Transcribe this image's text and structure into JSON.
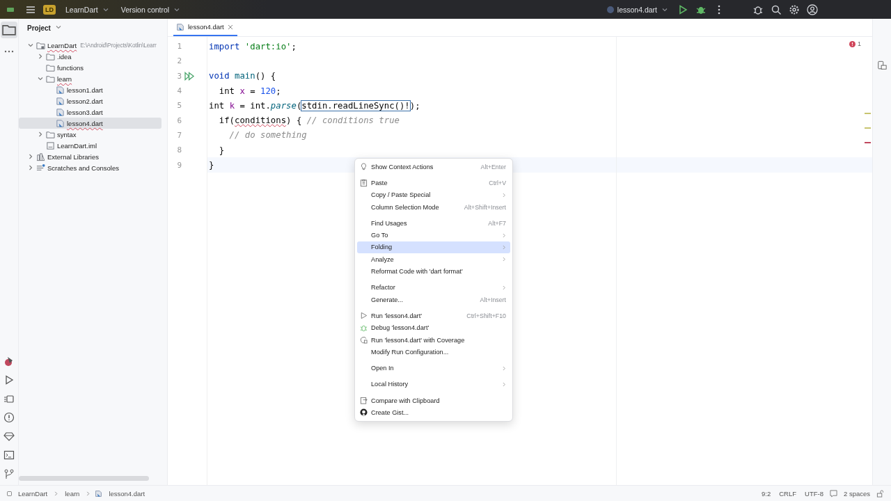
{
  "title_bar": {
    "project_badge": "LD",
    "project": "LearnDart",
    "vcs": "Version control",
    "run_config": "lesson4.dart"
  },
  "project_panel": {
    "title": "Project",
    "tree": [
      {
        "label": "LearnDart",
        "path": "E:\\Android\\Projects\\Kotlin\\Learr",
        "kind": "module",
        "expanded": true,
        "selected": false,
        "children": [
          {
            "label": ".idea",
            "kind": "folder",
            "expanded": false,
            "selected": false
          },
          {
            "label": "functions",
            "kind": "folder",
            "selected": false
          },
          {
            "label": "learn",
            "kind": "folder",
            "expanded": true,
            "selected": false,
            "children": [
              {
                "label": "lesson1.dart",
                "kind": "dart",
                "selected": false
              },
              {
                "label": "lesson2.dart",
                "kind": "dart",
                "selected": false
              },
              {
                "label": "lesson3.dart",
                "kind": "dart",
                "selected": false
              },
              {
                "label": "lesson4.dart",
                "kind": "dart",
                "selected": true
              }
            ]
          },
          {
            "label": "syntax",
            "kind": "folder",
            "expanded": false,
            "selected": false
          },
          {
            "label": "LearnDart.iml",
            "kind": "file",
            "selected": false
          }
        ]
      },
      {
        "label": "External Libraries",
        "kind": "library",
        "expanded": false,
        "selected": false
      },
      {
        "label": "Scratches and Consoles",
        "kind": "scratch",
        "expanded": false,
        "selected": false
      }
    ]
  },
  "editor": {
    "tab": "lesson4.dart",
    "problems": "1",
    "lines": [
      {
        "number": "1",
        "tokens": [
          {
            "kind": "keyword",
            "text": "import "
          },
          {
            "kind": "string",
            "text": "'dart:io'"
          },
          {
            "kind": "plain",
            "text": ";"
          }
        ]
      },
      {
        "number": "2"
      },
      {
        "number": "3",
        "run": true,
        "tokens": [
          {
            "kind": "keyword",
            "text": "void "
          },
          {
            "kind": "function",
            "text": "main"
          },
          {
            "kind": "plain",
            "text": "() {"
          }
        ]
      },
      {
        "number": "4",
        "tokens": [
          {
            "kind": "plain",
            "text": "  int "
          },
          {
            "kind": "variable",
            "text": "x"
          },
          {
            "kind": "plain",
            "text": " = "
          },
          {
            "kind": "number",
            "text": "120"
          },
          {
            "kind": "plain",
            "text": ";"
          }
        ]
      },
      {
        "number": "5",
        "tokens": [
          {
            "kind": "plain",
            "text": "int "
          },
          {
            "kind": "variable",
            "text": "k"
          },
          {
            "kind": "plain",
            "text": " = int."
          },
          {
            "kind": "italic",
            "text": "parse"
          },
          {
            "kind": "plain",
            "text": "("
          },
          {
            "kind": "boxed",
            "text": "stdin.readLineSync()!"
          },
          {
            "kind": "plain",
            "text": ");"
          }
        ]
      },
      {
        "number": "6",
        "tokens": [
          {
            "kind": "plain",
            "text": "  if("
          },
          {
            "kind": "error",
            "text": "conditions"
          },
          {
            "kind": "plain",
            "text": ") { "
          },
          {
            "kind": "comment",
            "text": "// conditions true"
          }
        ]
      },
      {
        "number": "7",
        "tokens": [
          {
            "kind": "comment",
            "text": "    // do something"
          }
        ]
      },
      {
        "number": "8",
        "tokens": [
          {
            "kind": "plain",
            "text": "  }"
          }
        ]
      },
      {
        "number": "9",
        "tokens": [
          {
            "kind": "plain",
            "text": "}"
          }
        ]
      }
    ]
  },
  "context_menu": [
    [
      {
        "label": "Show Context Actions",
        "shortcut": "Alt+Enter",
        "kind": "bulb",
        "submenu": false,
        "selected": false
      }
    ],
    [
      {
        "label": "Paste",
        "shortcut": "Ctrl+V",
        "kind": "clipboard",
        "submenu": false,
        "selected": false
      },
      {
        "label": "Copy / Paste Special",
        "submenu": true,
        "selected": false
      },
      {
        "label": "Column Selection Mode",
        "shortcut": "Alt+Shift+Insert",
        "submenu": false,
        "selected": false
      }
    ],
    [
      {
        "label": "Find Usages",
        "shortcut": "Alt+F7",
        "submenu": false,
        "selected": false
      },
      {
        "label": "Go To",
        "submenu": true,
        "selected": false
      },
      {
        "label": "Folding",
        "submenu": true,
        "selected": true
      },
      {
        "label": "Analyze",
        "submenu": true,
        "selected": false
      },
      {
        "label": "Reformat Code with 'dart format'",
        "submenu": false,
        "selected": false
      }
    ],
    [
      {
        "label": "Refactor",
        "submenu": true,
        "selected": false
      },
      {
        "label": "Generate...",
        "shortcut": "Alt+Insert",
        "submenu": false,
        "selected": false
      }
    ],
    [
      {
        "label": "Run 'lesson4.dart'",
        "shortcut": "Ctrl+Shift+F10",
        "kind": "run",
        "submenu": false,
        "selected": false
      },
      {
        "label": "Debug 'lesson4.dart'",
        "kind": "bug",
        "submenu": false,
        "selected": false
      },
      {
        "label": "Run 'lesson4.dart' with Coverage",
        "kind": "coverage",
        "submenu": false,
        "selected": false
      },
      {
        "label": "Modify Run Configuration...",
        "submenu": false,
        "selected": false
      }
    ],
    [
      {
        "label": "Open In",
        "submenu": true,
        "selected": false
      }
    ],
    [
      {
        "label": "Local History",
        "submenu": true,
        "selected": false
      }
    ],
    [
      {
        "label": "Compare with Clipboard",
        "kind": "compare",
        "submenu": false,
        "selected": false
      },
      {
        "label": "Create Gist...",
        "kind": "github",
        "submenu": false,
        "selected": false
      }
    ]
  ],
  "breadcrumbs": [
    "LearnDart",
    "learn",
    "lesson4.dart"
  ],
  "status_bar": {
    "position": "9:2",
    "line_ending": "CRLF",
    "encoding": "UTF-8",
    "indent": "2 spaces"
  }
}
